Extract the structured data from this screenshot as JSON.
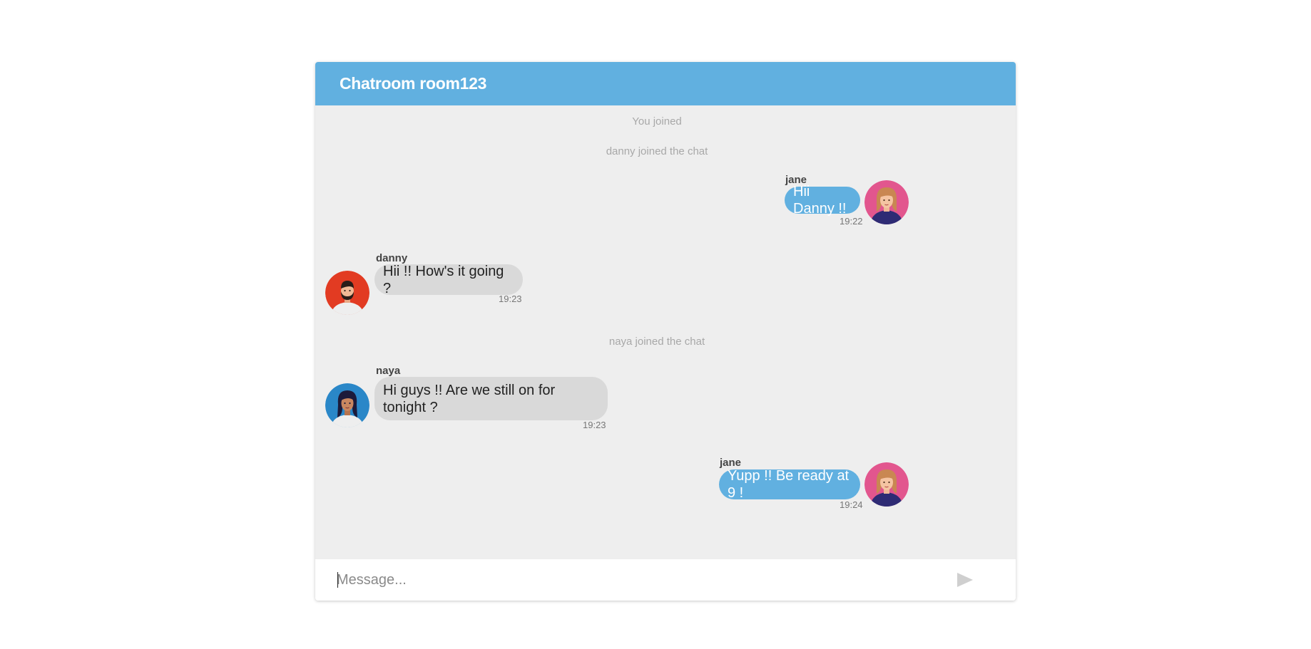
{
  "header": {
    "title": "Chatroom room123"
  },
  "system_messages": [
    "You joined",
    "danny joined the chat",
    "naya joined the chat"
  ],
  "messages": [
    {
      "sender": "jane",
      "text": "Hii Danny !!",
      "time": "19:22",
      "mine": true,
      "avatar": "woman-avatar-icon"
    },
    {
      "sender": "danny",
      "text": "Hii !! How's it going ?",
      "time": "19:23",
      "mine": false,
      "avatar": "man-avatar-icon"
    },
    {
      "sender": "naya",
      "line1": "Hi guys !! Are we still on for",
      "line2": "tonight ?",
      "time": "19:23",
      "mine": false,
      "avatar": "woman-avatar-icon"
    },
    {
      "sender": "jane",
      "text": "Yupp !! Be ready at 9 !",
      "time": "19:24",
      "mine": true,
      "avatar": "woman-avatar-icon"
    }
  ],
  "input": {
    "placeholder": "Message...",
    "value": ""
  },
  "send_icon": "send-icon",
  "colors": {
    "header_bg": "#61b0e0",
    "my_bubble": "#61b0e0",
    "their_bubble": "#d9d9d9",
    "chat_bg": "#eeeeee",
    "jane_avatar_bg": "#e2568e",
    "danny_avatar_bg": "#e23b22",
    "naya_avatar_bg": "#2a87c8"
  }
}
